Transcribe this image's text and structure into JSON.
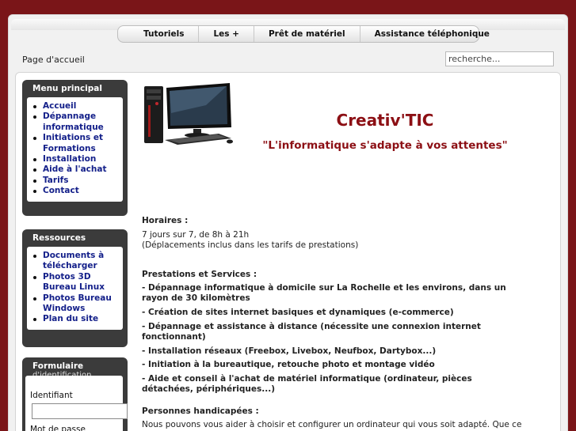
{
  "topnav": {
    "items": [
      "Tutoriels",
      "Les +",
      "Prêt de matériel",
      "Assistance téléphonique"
    ]
  },
  "breadcrumb": "Page d'accueil",
  "search": {
    "placeholder": "recherche..."
  },
  "menu_principal": {
    "title": "Menu principal",
    "items": [
      "Accueil",
      "Dépannage informatique",
      "Initiations et Formations",
      "Installation",
      "Aide à l'achat",
      "Tarifs",
      "Contact"
    ]
  },
  "ressources": {
    "title": "Ressources",
    "items": [
      "Documents à télécharger",
      "Photos 3D Bureau Linux",
      "Photos Bureau Windows",
      "Plan du site"
    ]
  },
  "formulaire": {
    "title": "Formulaire",
    "subtitle": "d'identification",
    "identifiant_label": "Identifiant",
    "password_label": "Mot de passe"
  },
  "header": {
    "title": "Creativ'TIC",
    "slogan": "\"L'informatique s'adapte à vos attentes\""
  },
  "horaires": {
    "heading": "Horaires :",
    "line1": "7 jours sur 7, de 8h à 21h",
    "line2": "(Déplacements inclus dans les tarifs de prestations)"
  },
  "prestations": {
    "heading": "Prestations et Services :",
    "items": [
      "- Dépannage informatique à domicile sur La Rochelle et les environs, dans un rayon de 30 kilomètres",
      "- Création de sites internet basiques et dynamiques (e-commerce)",
      "- Dépannage et assistance à distance (nécessite une connexion internet fonctionnant)",
      "- Installation réseaux (Freebox, Livebox, Neufbox, Dartybox...)",
      "- Initiation à la bureautique, retouche photo et montage vidéo",
      "- Aide et conseil à l'achat de matériel informatique (ordinateur, pièces détachées, périphériques...)"
    ]
  },
  "handicap": {
    "heading": "Personnes handicapées :",
    "text": "Nous pouvons vous aider à choisir et configurer un ordinateur qui vous soit adapté. Que ce soit sous"
  },
  "colors": {
    "background": "#7a1518",
    "title": "#8c0f14",
    "link": "#14208a",
    "module": "#3b3b3b"
  }
}
